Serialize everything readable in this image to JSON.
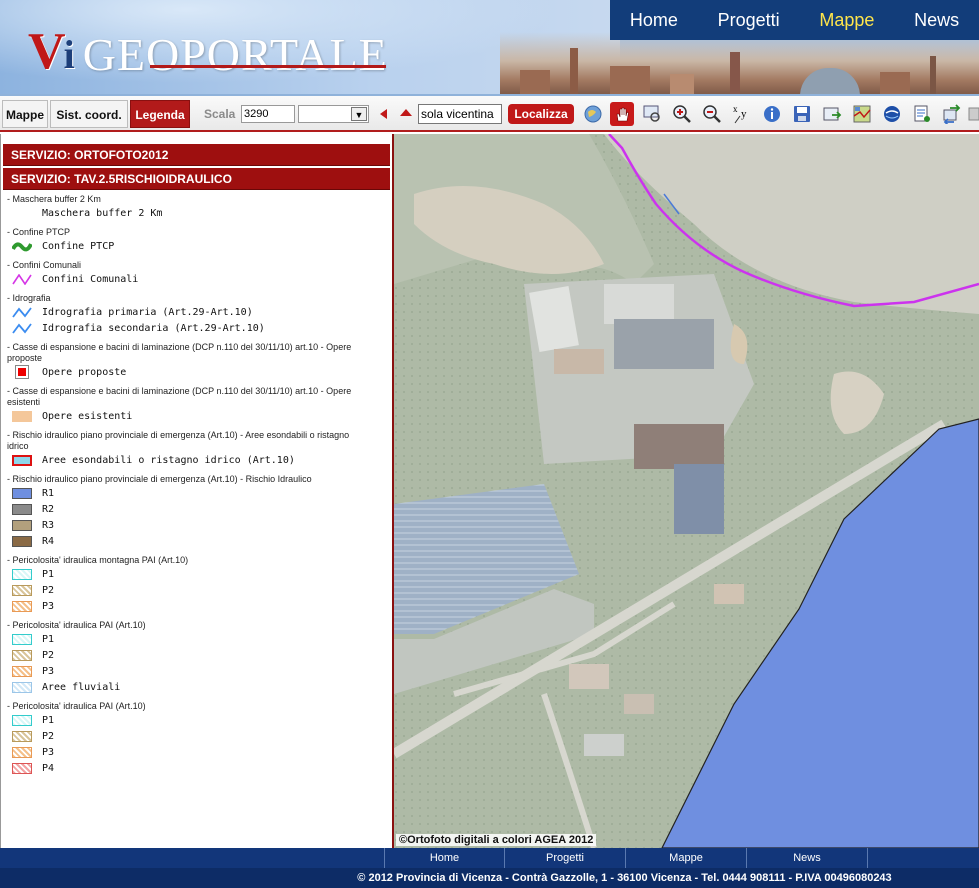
{
  "header": {
    "logo_vi": "V",
    "logo_dot": "i",
    "logo_text": "GEOPORTALE",
    "nav": [
      "Home",
      "Progetti",
      "Mappe",
      "News"
    ],
    "nav_active": "Mappe"
  },
  "toolbar": {
    "tabs": [
      "Mappe",
      "Sist. coord.",
      "Legenda"
    ],
    "active_tab": "Legenda",
    "scala_label": "Scala",
    "scala_value": "3290",
    "locate_value": "sola vicentina",
    "locate_button": "Localizza",
    "tools": [
      "globe-icon",
      "pan-hand-icon",
      "zoom-box-icon",
      "zoom-in-icon",
      "zoom-out-icon",
      "coordinates-xy-icon",
      "info-icon",
      "save-icon",
      "export-icon",
      "map-layer-icon",
      "earth-icon",
      "print-icon",
      "refresh-icon",
      "more-icon"
    ]
  },
  "legend": {
    "services": [
      "SERVIZIO: ORTOFOTO2012",
      "SERVIZIO: TAV.2.5RISCHIOIDRAULICO"
    ],
    "groups": [
      {
        "title": "- Maschera buffer 2 Km",
        "items": [
          {
            "label": "Maschera buffer 2 Km",
            "swatch": "none"
          }
        ]
      },
      {
        "title": "- Confine PTCP",
        "items": [
          {
            "label": "Confine PTCP",
            "swatch": "green-line"
          }
        ]
      },
      {
        "title": "- Confini Comunali",
        "items": [
          {
            "label": "Confini Comunali",
            "swatch": "magenta-line"
          }
        ]
      },
      {
        "title": "- Idrografia",
        "items": [
          {
            "label": "Idrografia primaria (Art.29-Art.10)",
            "swatch": "blue-line"
          },
          {
            "label": "Idrografia secondaria (Art.29-Art.10)",
            "swatch": "blue-line"
          }
        ]
      },
      {
        "title": "- Casse di espansione e bacini di laminazione (DCP n.110 del 30/11/10) art.10 - Opere proposte",
        "items": [
          {
            "label": "Opere proposte",
            "swatch": "red-square"
          }
        ]
      },
      {
        "title": "- Casse di espansione e bacini di laminazione (DCP n.110 del 30/11/10) art.10 - Opere esistenti",
        "items": [
          {
            "label": "Opere esistenti",
            "swatch": "orange-fill"
          }
        ]
      },
      {
        "title": "- Rischio idraulico piano provinciale di emergenza (Art.10) - Aree esondabili o ristagno idrico",
        "items": [
          {
            "label": "Aree esondabili o ristagno idrico (Art.10)",
            "swatch": "cyan-red-border"
          }
        ]
      },
      {
        "title": "- Rischio idraulico piano provinciale di emergenza (Art.10) - Rischio Idraulico",
        "items": [
          {
            "label": "R1",
            "swatch": "#6f8fe0"
          },
          {
            "label": "R2",
            "swatch": "#8a8a8a"
          },
          {
            "label": "R3",
            "swatch": "#b2a07d"
          },
          {
            "label": "R4",
            "swatch": "#8a6a45"
          }
        ]
      },
      {
        "title": "- Pericolosita' idraulica montagna PAI (Art.10)",
        "items": [
          {
            "label": "P1",
            "swatch": "hatch-cyan"
          },
          {
            "label": "P2",
            "swatch": "hatch-tan"
          },
          {
            "label": "P3",
            "swatch": "hatch-orange"
          }
        ]
      },
      {
        "title": "- Pericolosita' idraulica PAI (Art.10)",
        "items": [
          {
            "label": "P1",
            "swatch": "hatch-cyan"
          },
          {
            "label": "P2",
            "swatch": "hatch-tan"
          },
          {
            "label": "P3",
            "swatch": "hatch-orange"
          },
          {
            "label": "Aree fluviali",
            "swatch": "hatch-lightblue"
          }
        ]
      },
      {
        "title": "- Pericolosita' idraulica PAI (Art.10)",
        "items": [
          {
            "label": "P1",
            "swatch": "hatch-cyan"
          },
          {
            "label": "P2",
            "swatch": "hatch-tan"
          },
          {
            "label": "P3",
            "swatch": "hatch-orange"
          },
          {
            "label": "P4",
            "swatch": "hatch-red"
          }
        ]
      }
    ]
  },
  "map": {
    "attribution": "©Ortofoto digitali a colori AGEA 2012",
    "colors": {
      "flood_zone": "#6f8fe0",
      "boundary": "#cc33ee"
    }
  },
  "footer": {
    "nav": [
      "Home",
      "Progetti",
      "Mappe",
      "News"
    ],
    "info": "© 2012 Provincia di Vicenza - Contrà Gazzolle, 1 - 36100 Vicenza - Tel. 0444 908111 - P.IVA 00496080243"
  }
}
